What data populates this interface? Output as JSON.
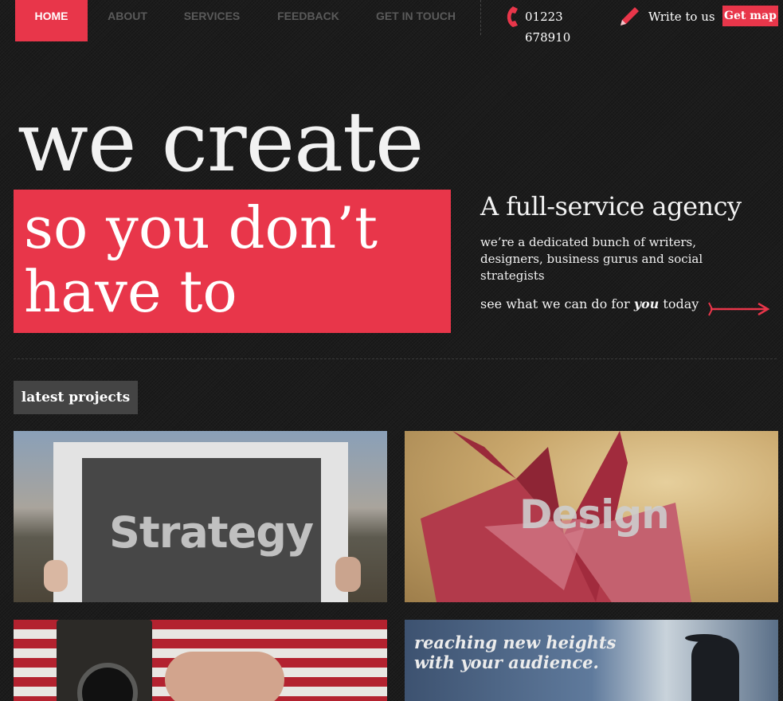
{
  "nav": {
    "items": [
      {
        "label": "HOME",
        "active": true
      },
      {
        "label": "ABOUT",
        "active": false
      },
      {
        "label": "SERVICES",
        "active": false
      },
      {
        "label": "FEEDBACK",
        "active": false
      },
      {
        "label": "GET IN TOUCH",
        "active": false
      }
    ],
    "phone": "01223 678910",
    "write_label": "Write to us",
    "map_label": "Get map"
  },
  "hero": {
    "line1": "we create",
    "line2": "so you don’t",
    "line3": "have to"
  },
  "agency": {
    "title": "A full-service agency",
    "description": "we’re a dedicated bunch of writers, designers, business gurus and social strategists",
    "cta_prefix": "see what we can do for ",
    "cta_emphasis": "you",
    "cta_suffix": " today"
  },
  "projects": {
    "heading": "latest projects",
    "tiles": [
      {
        "label": "Strategy"
      },
      {
        "label": "Design"
      },
      {
        "label": ""
      },
      {
        "label": "",
        "caption": "reaching new heights with your audience."
      }
    ]
  },
  "colors": {
    "accent": "#e8364a",
    "background": "#1c1c1c",
    "tag_bg": "#444444"
  },
  "icons": [
    "phone-icon",
    "pencil-icon",
    "arrow-right-icon"
  ]
}
